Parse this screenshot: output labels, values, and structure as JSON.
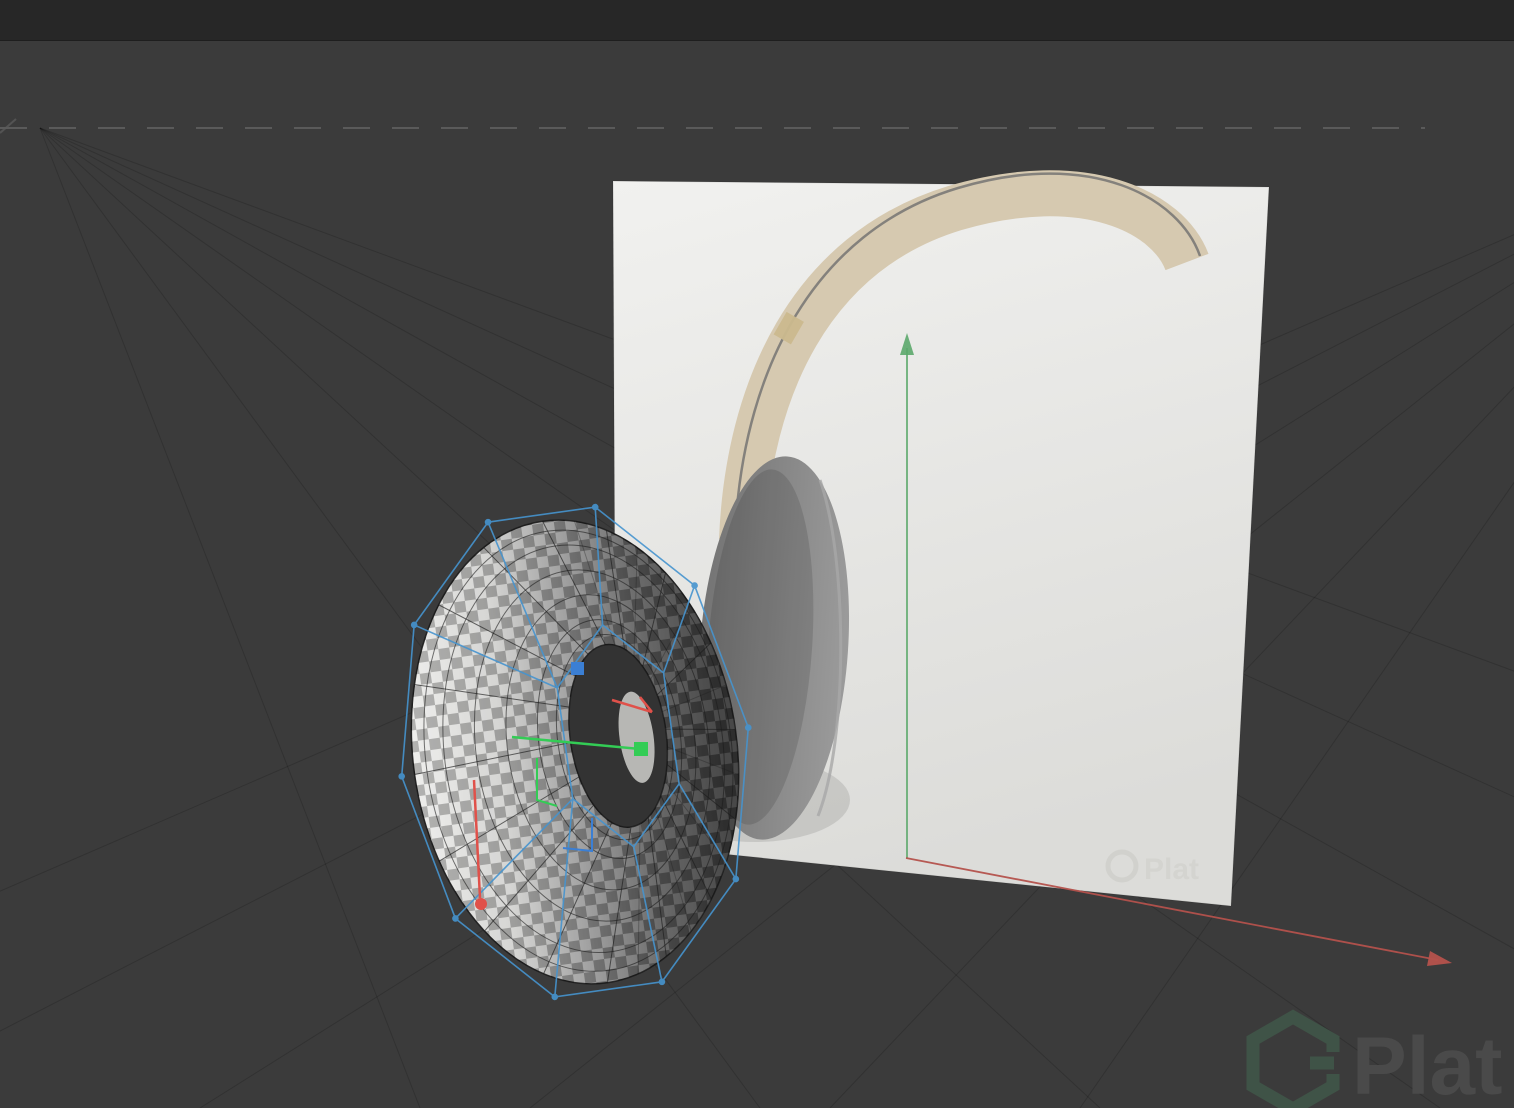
{
  "colors": {
    "bg": "#3b3b3b",
    "topbar": "#272727",
    "horizon": "#5a5a5a",
    "grid": "#2e2e2e",
    "axis-x": "#b5524c",
    "axis-y": "#5ca96b",
    "gizmo-x": "#e0514a",
    "gizmo-y": "#33cc55",
    "gizmo-z": "#3b7fd4",
    "cage": "#4694cf",
    "plane": "#eaeae8",
    "band": "#d6c9b0",
    "band-edge": "#6f6f6f",
    "cup": "#8d8d8d",
    "watermark-logo": "#3f5347",
    "watermark-text": "#4a4a4a"
  },
  "watermark": {
    "text": "Plat",
    "plane_text": "Plat"
  }
}
